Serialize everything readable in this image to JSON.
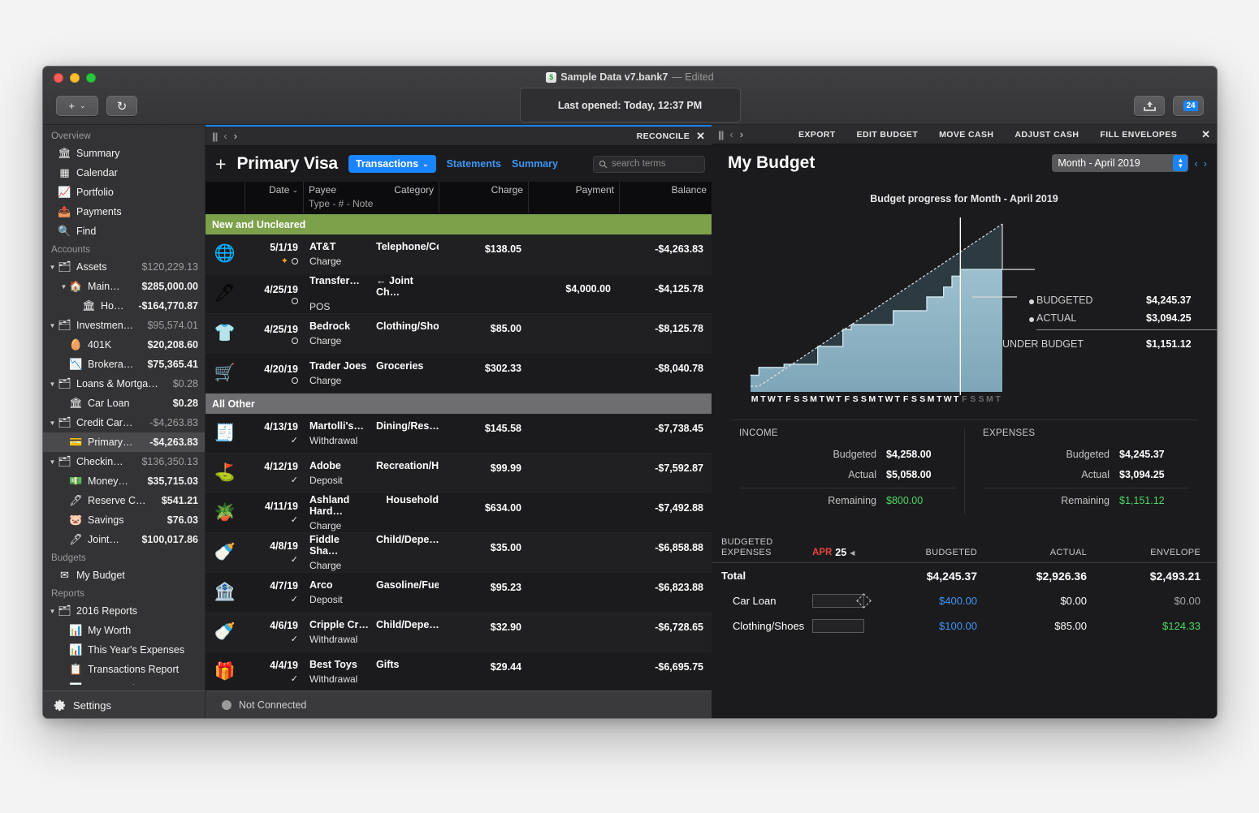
{
  "window": {
    "doc_title": "Sample Data v7.bank7",
    "doc_state": "— Edited",
    "last_opened": "Last opened: Today, 12:37 PM",
    "toolbar": {
      "add_label": "+",
      "refresh_icon": "↻",
      "upload_icon": "upload-icon",
      "calendar_badge": "24"
    }
  },
  "sidebar": {
    "sections": [
      {
        "title": "Overview",
        "items": [
          {
            "icon": "bank-icon",
            "label": "Summary",
            "amount": "",
            "level": 1,
            "disclosure": ""
          },
          {
            "icon": "calendar-icon",
            "label": "Calendar",
            "amount": "",
            "level": 1,
            "disclosure": ""
          },
          {
            "icon": "chart-icon",
            "label": "Portfolio",
            "amount": "",
            "level": 1,
            "disclosure": ""
          },
          {
            "icon": "payments-icon",
            "label": "Payments",
            "amount": "",
            "level": 1,
            "disclosure": ""
          },
          {
            "icon": "search-icon",
            "label": "Find",
            "amount": "",
            "level": 1,
            "disclosure": ""
          }
        ]
      },
      {
        "title": "Accounts",
        "items": [
          {
            "icon": "folder-icon",
            "label": "Assets",
            "amount": "$120,229.13",
            "level": 1,
            "disclosure": "▼",
            "dim": true
          },
          {
            "icon": "house-icon",
            "label": "Main…",
            "amount": "$285,000.00",
            "level": 2,
            "disclosure": "▼"
          },
          {
            "icon": "bank-icon",
            "label": "Ho…",
            "amount": "-$164,770.87",
            "level": 3,
            "disclosure": ""
          },
          {
            "icon": "folder-icon",
            "label": "Investmen…",
            "amount": "$95,574.01",
            "level": 1,
            "disclosure": "▼",
            "dim": true
          },
          {
            "icon": "nest-icon",
            "label": "401K",
            "amount": "$20,208.60",
            "level": 2,
            "disclosure": ""
          },
          {
            "icon": "brokerage-icon",
            "label": "Brokera…",
            "amount": "$75,365.41",
            "level": 2,
            "disclosure": ""
          },
          {
            "icon": "folder-icon",
            "label": "Loans & Mortga…",
            "amount": "$0.28",
            "level": 1,
            "disclosure": "▼",
            "dim": true
          },
          {
            "icon": "bank-icon",
            "label": "Car Loan",
            "amount": "$0.28",
            "level": 2,
            "disclosure": ""
          },
          {
            "icon": "folder-icon",
            "label": "Credit Car…",
            "amount": "-$4,263.83",
            "level": 1,
            "disclosure": "▼",
            "dim": true
          },
          {
            "icon": "card-icon",
            "label": "Primary…",
            "amount": "-$4,263.83",
            "level": 2,
            "disclosure": "",
            "selected": true
          },
          {
            "icon": "folder-icon",
            "label": "Checkin…",
            "amount": "$136,350.13",
            "level": 1,
            "disclosure": "▼",
            "dim": true
          },
          {
            "icon": "money-icon",
            "label": "Money…",
            "amount": "$35,715.03",
            "level": 2,
            "disclosure": ""
          },
          {
            "icon": "check-icon",
            "label": "Reserve C…",
            "amount": "$541.21",
            "level": 2,
            "disclosure": ""
          },
          {
            "icon": "piggy-icon",
            "label": "Savings",
            "amount": "$76.03",
            "level": 2,
            "disclosure": ""
          },
          {
            "icon": "check-icon",
            "label": "Joint…",
            "amount": "$100,017.86",
            "level": 2,
            "disclosure": ""
          }
        ]
      },
      {
        "title": "Budgets",
        "items": [
          {
            "icon": "budget-icon",
            "label": "My Budget",
            "amount": "",
            "level": 1,
            "disclosure": ""
          }
        ]
      },
      {
        "title": "Reports",
        "items": [
          {
            "icon": "folder-icon",
            "label": "2016 Reports",
            "amount": "",
            "level": 1,
            "disclosure": "▼"
          },
          {
            "icon": "report-icon",
            "label": "My Worth",
            "amount": "",
            "level": 2,
            "disclosure": ""
          },
          {
            "icon": "report-icon",
            "label": "This Year's Expenses",
            "amount": "",
            "level": 2,
            "disclosure": ""
          },
          {
            "icon": "table-icon",
            "label": "Transactions Report",
            "amount": "",
            "level": 2,
            "disclosure": ""
          },
          {
            "icon": "report-icon",
            "label": "Last Month to Date Ex",
            "amount": "",
            "level": 2,
            "disclosure": ""
          }
        ]
      }
    ],
    "settings_label": "Settings",
    "settings_icon": "gear-icon"
  },
  "center": {
    "panelbar": {
      "reconcile": "RECONCILE",
      "close": "✕"
    },
    "account_name": "Primary Visa",
    "add_icon": "+",
    "tabs": [
      {
        "label": "Transactions",
        "active": true,
        "has_caret": true
      },
      {
        "label": "Statements",
        "active": false
      },
      {
        "label": "Summary",
        "active": false
      }
    ],
    "search_placeholder": "search terms",
    "columns": {
      "date": "Date",
      "payee": "Payee",
      "category": "Category",
      "charge": "Charge",
      "payment": "Payment",
      "balance": "Balance",
      "sub": "Type  -  #  -  Note"
    },
    "groups": [
      {
        "label": "New and Uncleared",
        "style": "green",
        "rows": [
          {
            "icon": "🌐",
            "date": "5/1/19",
            "flags": [
              "star",
              "circle"
            ],
            "payee": "AT&T",
            "category": "Telephone/Cellular",
            "type": "Charge",
            "charge": "$138.05",
            "payment": "",
            "balance": "-$4,263.83"
          },
          {
            "icon": "🖊",
            "date": "4/25/19",
            "flags": [
              "circle"
            ],
            "payee": "Transfer…",
            "category": "← Joint Ch…",
            "type": "POS",
            "charge": "",
            "payment": "$4,000.00",
            "balance": "-$4,125.78"
          },
          {
            "icon": "👕",
            "date": "4/25/19",
            "flags": [
              "circle"
            ],
            "payee": "Bedrock",
            "category": "Clothing/Shoes",
            "type": "Charge",
            "charge": "$85.00",
            "payment": "",
            "balance": "-$8,125.78"
          },
          {
            "icon": "🛒",
            "date": "4/20/19",
            "flags": [
              "circle"
            ],
            "payee": "Trader Joes",
            "category": "Groceries",
            "type": "Charge",
            "charge": "$302.33",
            "payment": "",
            "balance": "-$8,040.78"
          }
        ]
      },
      {
        "label": "All Other",
        "style": "gray",
        "rows": [
          {
            "icon": "🧾",
            "date": "4/13/19",
            "flags": [
              "check"
            ],
            "payee": "Martolli's…",
            "category": "Dining/Res…",
            "type": "Withdrawal",
            "charge": "$145.58",
            "payment": "",
            "balance": "-$7,738.45"
          },
          {
            "icon": "⛳",
            "date": "4/12/19",
            "flags": [
              "check"
            ],
            "payee": "Adobe",
            "category": "Recreation/Hobbies",
            "type": "Deposit",
            "charge": "$99.99",
            "payment": "",
            "balance": "-$7,592.87"
          },
          {
            "icon": "🪴",
            "date": "4/11/19",
            "flags": [
              "check"
            ],
            "payee": "Ashland Hard…",
            "category": "Household",
            "type": "Charge",
            "charge": "$634.00",
            "payment": "",
            "balance": "-$7,492.88"
          },
          {
            "icon": "🍼",
            "date": "4/8/19",
            "flags": [
              "check"
            ],
            "payee": "Fiddle Sha…",
            "category": "Child/Depe…",
            "type": "Charge",
            "charge": "$35.00",
            "payment": "",
            "balance": "-$6,858.88"
          },
          {
            "icon": "🏦",
            "date": "4/7/19",
            "flags": [
              "check"
            ],
            "payee": "Arco",
            "category": "Gasoline/Fuel",
            "type": "Deposit",
            "charge": "$95.23",
            "payment": "",
            "balance": "-$6,823.88"
          },
          {
            "icon": "🍼",
            "date": "4/6/19",
            "flags": [
              "check"
            ],
            "payee": "Cripple Cr…",
            "category": "Child/Depe…",
            "type": "Withdrawal",
            "charge": "$32.90",
            "payment": "",
            "balance": "-$6,728.65"
          },
          {
            "icon": "🎁",
            "date": "4/4/19",
            "flags": [
              "check"
            ],
            "payee": "Best Toys",
            "category": "Gifts",
            "type": "Withdrawal",
            "charge": "$29.44",
            "payment": "",
            "balance": "-$6,695.75"
          }
        ]
      }
    ],
    "status": "Not Connected"
  },
  "right": {
    "panelbar_actions": [
      "EXPORT",
      "EDIT BUDGET",
      "MOVE CASH",
      "ADJUST CASH",
      "FILL ENVELOPES"
    ],
    "close": "✕",
    "title": "My Budget",
    "period": "Month - April 2019",
    "chart_data": {
      "type": "area",
      "title": "Budget progress for Month - April 2019",
      "categories": [
        "M",
        "T",
        "W",
        "T",
        "F",
        "S",
        "S",
        "M",
        "T",
        "W",
        "T",
        "F",
        "S",
        "S",
        "M",
        "T",
        "W",
        "T",
        "F",
        "S",
        "S",
        "M",
        "T",
        "W",
        "T",
        "F",
        "S",
        "S",
        "M",
        "T"
      ],
      "dim_from_index": 25,
      "xlabel": "",
      "ylabel": "",
      "ylim": [
        0,
        4245.37
      ],
      "grid": false,
      "legend_position": "right",
      "series": [
        {
          "name": "BUDGETED",
          "style": "dashed-line",
          "values": [
            141,
            283,
            424,
            566,
            707,
            849,
            990,
            1132,
            1273,
            1415,
            1556,
            1698,
            1839,
            1981,
            2122,
            2264,
            2405,
            2547,
            2688,
            2830,
            2971,
            3113,
            3254,
            3396,
            3537,
            3679,
            3820,
            3962,
            4103,
            4245
          ]
        },
        {
          "name": "ACTUAL",
          "style": "step-area",
          "values": [
            420,
            620,
            620,
            620,
            700,
            700,
            700,
            700,
            1150,
            1150,
            1150,
            1580,
            1700,
            1700,
            1700,
            1700,
            1700,
            2050,
            2050,
            2050,
            2050,
            2400,
            2400,
            2650,
            2926,
            3094,
            3094,
            3094,
            3094,
            3094
          ]
        }
      ],
      "annotations": [
        {
          "label": "BUDGETED",
          "value": "$4,245.37"
        },
        {
          "label": "ACTUAL",
          "value": "$3,094.25"
        },
        {
          "label": "UNDER BUDGET",
          "value": "$1,151.12"
        }
      ],
      "today_marker_index": 25
    },
    "summary": {
      "income": {
        "header": "INCOME",
        "budgeted_label": "Budgeted",
        "budgeted": "$4,258.00",
        "actual_label": "Actual",
        "actual": "$5,058.00",
        "remaining_label": "Remaining",
        "remaining": "$800.00"
      },
      "expenses": {
        "header": "EXPENSES",
        "budgeted_label": "Budgeted",
        "budgeted": "$4,245.37",
        "actual_label": "Actual",
        "actual": "$3,094.25",
        "remaining_label": "Remaining",
        "remaining": "$1,151.12"
      }
    },
    "budget_table": {
      "head": {
        "title_l1": "BUDGETED",
        "title_l2": "EXPENSES",
        "month": "APR",
        "day": "25",
        "caret": "◀",
        "budgeted": "BUDGETED",
        "actual": "ACTUAL",
        "envelope": "ENVELOPE"
      },
      "rows": [
        {
          "name": "Total",
          "bar": null,
          "budgeted": "$4,245.37",
          "actual": "$2,926.36",
          "envelope": "$2,493.21",
          "total": true
        },
        {
          "name": "Car Loan",
          "bar": {
            "fill": 0,
            "handle": true
          },
          "budgeted": "$400.00",
          "actual": "$0.00",
          "envelope": "$0.00",
          "envelope_style": "dim"
        },
        {
          "name": "Clothing/Shoes",
          "bar": {
            "fill": 85,
            "handle": false
          },
          "budgeted": "$100.00",
          "actual": "$85.00",
          "envelope": "$124.33",
          "envelope_style": "green"
        }
      ]
    }
  }
}
